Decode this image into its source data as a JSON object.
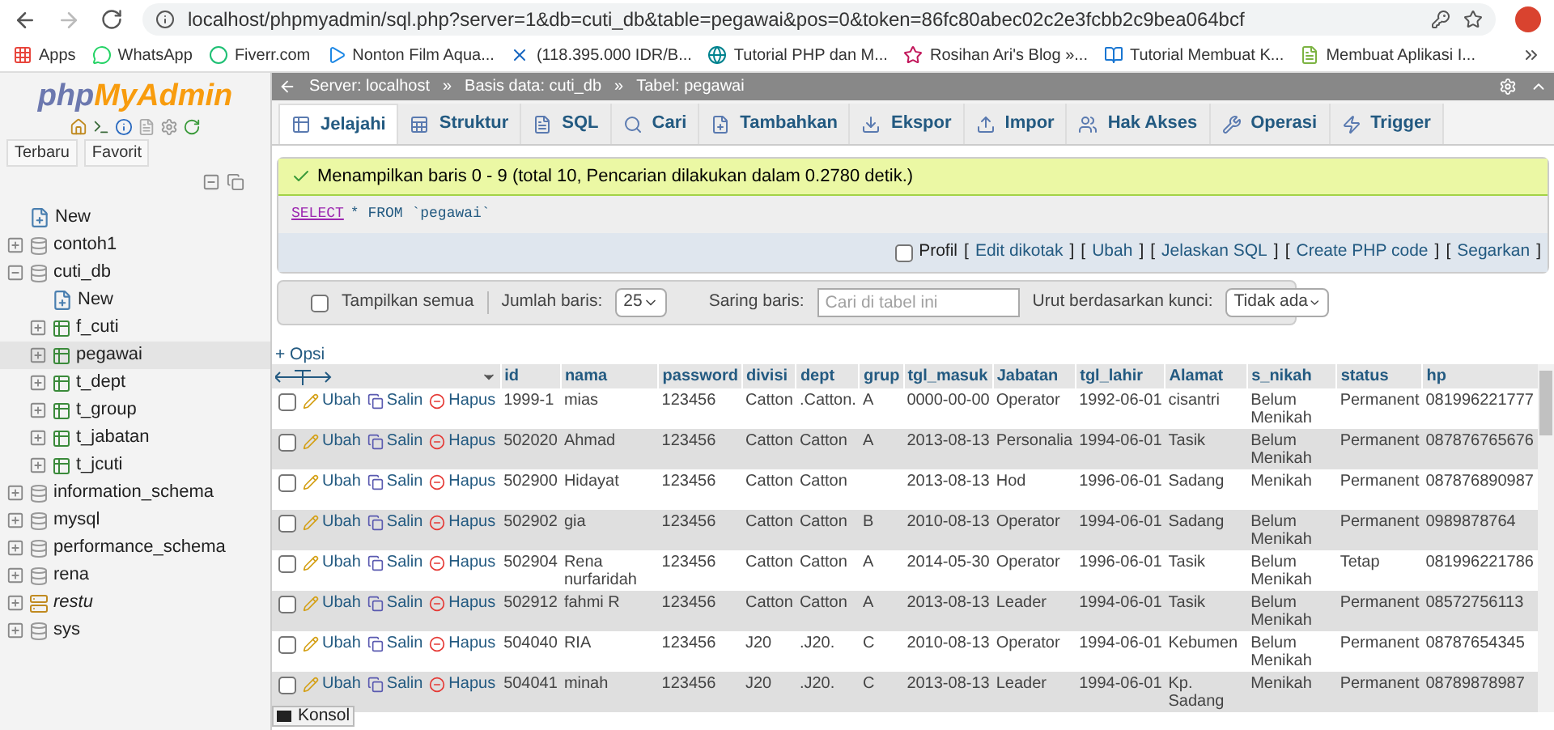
{
  "browser": {
    "url": "localhost/phpmyadmin/sql.php?server=1&db=cuti_db&table=pegawai&pos=0&token=86fc80abec02c2e3fcbb2c9bea064bcf",
    "bookmarks": [
      "Apps",
      "WhatsApp",
      "Fiverr.com",
      "Nonton Film Aqua...",
      "(118.395.000 IDR/B...",
      "Tutorial PHP dan M...",
      "Rosihan Ari's Blog »...",
      "Tutorial Membuat K...",
      "Membuat Aplikasi I..."
    ]
  },
  "sidebar": {
    "logo": {
      "php": "php",
      "name": "MyAdmin"
    },
    "tabs": [
      "Terbaru",
      "Favorit"
    ],
    "tree": [
      {
        "label": "New",
        "kind": "new",
        "selected": false
      },
      {
        "label": "contoh1",
        "kind": "db",
        "expanded": false,
        "selected": false
      },
      {
        "label": "cuti_db",
        "kind": "db",
        "expanded": true,
        "selected": false,
        "children": [
          {
            "label": "New",
            "kind": "new",
            "selected": false
          },
          {
            "label": "f_cuti",
            "kind": "table",
            "expanded": false,
            "selected": false
          },
          {
            "label": "pegawai",
            "kind": "table",
            "expanded": false,
            "selected": true
          },
          {
            "label": "t_dept",
            "kind": "table",
            "expanded": false,
            "selected": false
          },
          {
            "label": "t_group",
            "kind": "table",
            "expanded": false,
            "selected": false
          },
          {
            "label": "t_jabatan",
            "kind": "table",
            "expanded": false,
            "selected": false
          },
          {
            "label": "t_jcuti",
            "kind": "table",
            "expanded": false,
            "selected": false
          }
        ]
      },
      {
        "label": "information_schema",
        "kind": "db",
        "expanded": false,
        "selected": false
      },
      {
        "label": "mysql",
        "kind": "db",
        "expanded": false,
        "selected": false
      },
      {
        "label": "performance_schema",
        "kind": "db",
        "expanded": false,
        "selected": false
      },
      {
        "label": "rena",
        "kind": "db",
        "expanded": false,
        "selected": false
      },
      {
        "label": "restu",
        "kind": "db_special",
        "expanded": false,
        "selected": false
      },
      {
        "label": "sys",
        "kind": "db",
        "expanded": false,
        "selected": false
      }
    ]
  },
  "breadcrumb": {
    "separator": "»",
    "items": [
      "Server: localhost",
      "Basis data: cuti_db",
      "Tabel: pegawai"
    ]
  },
  "tabs": [
    {
      "label": "Jelajahi",
      "selected": true
    },
    {
      "label": "Struktur",
      "selected": false
    },
    {
      "label": "SQL",
      "selected": false
    },
    {
      "label": "Cari",
      "selected": false
    },
    {
      "label": "Tambahkan",
      "selected": false
    },
    {
      "label": "Ekspor",
      "selected": false
    },
    {
      "label": "Impor",
      "selected": false
    },
    {
      "label": "Hak Akses",
      "selected": false
    },
    {
      "label": "Operasi",
      "selected": false
    },
    {
      "label": "Trigger",
      "selected": false
    }
  ],
  "message": "Menampilkan baris 0 - 9 (total 10, Pencarian dilakukan dalam 0.2780 detik.)",
  "query": {
    "keyword": "SELECT",
    "rest": "* FROM `pegawai`"
  },
  "query_options": {
    "profil": {
      "label": "Profil",
      "checked": false
    },
    "open": "[",
    "close": "]",
    "links": [
      "Edit dikotak",
      "Ubah",
      "Jelaskan SQL",
      "Create PHP code",
      "Segarkan"
    ]
  },
  "filter_bar": {
    "show_all": {
      "label": "Tampilkan semua",
      "checked": false
    },
    "rows_label": "Jumlah baris:",
    "rows_value": "25",
    "filter_label": "Saring baris:",
    "filter_placeholder": "Cari di tabel ini",
    "sort_label": "Urut berdasarkan kunci:",
    "sort_value": "Tidak ada"
  },
  "options_link": "+ Opsi",
  "table": {
    "columns": [
      "id",
      "nama",
      "password",
      "divisi",
      "dept",
      "grup",
      "tgl_masuk",
      "Jabatan",
      "tgl_lahir",
      "Alamat",
      "s_nikah",
      "status",
      "hp"
    ],
    "rows": [
      {
        "checked": false,
        "actions": [
          "Ubah",
          "Salin",
          "Hapus"
        ],
        "cells": [
          "1999-1",
          "mias",
          "123456",
          "Catton",
          ".Catton.",
          "A",
          "0000-00-00",
          "Operator",
          "1992-06-01",
          "cisantri",
          "Belum Menikah",
          "Permanent",
          "081996221777"
        ]
      },
      {
        "checked": false,
        "actions": [
          "Ubah",
          "Salin",
          "Hapus"
        ],
        "cells": [
          "502020",
          "Ahmad",
          "123456",
          "Catton",
          "Catton",
          "A",
          "2013-08-13",
          "Personalia",
          "1994-06-01",
          "Tasik",
          "Belum Menikah",
          "Permanent",
          "087876765676"
        ]
      },
      {
        "checked": false,
        "actions": [
          "Ubah",
          "Salin",
          "Hapus"
        ],
        "cells": [
          "502900",
          "Hidayat",
          "123456",
          "Catton",
          "Catton",
          "",
          "2013-08-13",
          "Hod",
          "1996-06-01",
          "Sadang",
          "Menikah",
          "Permanent",
          "087876890987"
        ]
      },
      {
        "checked": false,
        "actions": [
          "Ubah",
          "Salin",
          "Hapus"
        ],
        "cells": [
          "502902",
          "gia",
          "123456",
          "Catton",
          "Catton",
          "B",
          "2010-08-13",
          "Operator",
          "1994-06-01",
          "Sadang",
          "Belum Menikah",
          "Permanent",
          "0989878764"
        ]
      },
      {
        "checked": false,
        "actions": [
          "Ubah",
          "Salin",
          "Hapus"
        ],
        "cells": [
          "502904",
          "Rena nurfaridah",
          "123456",
          "Catton",
          "Catton",
          "A",
          "2014-05-30",
          "Operator",
          "1996-06-01",
          "Tasik",
          "Belum Menikah",
          "Tetap",
          "081996221786"
        ]
      },
      {
        "checked": false,
        "actions": [
          "Ubah",
          "Salin",
          "Hapus"
        ],
        "cells": [
          "502912",
          "fahmi R",
          "123456",
          "Catton",
          "Catton",
          "A",
          "2013-08-13",
          "Leader",
          "1994-06-01",
          "Tasik",
          "Belum Menikah",
          "Permanent",
          "08572756113"
        ]
      },
      {
        "checked": false,
        "actions": [
          "Ubah",
          "Salin",
          "Hapus"
        ],
        "cells": [
          "504040",
          "RIA",
          "123456",
          "J20",
          ".J20.",
          "C",
          "2010-08-13",
          "Operator",
          "1994-06-01",
          "Kebumen",
          "Belum Menikah",
          "Permanent",
          "08787654345"
        ]
      },
      {
        "checked": false,
        "actions": [
          "Ubah",
          "Salin",
          "Hapus"
        ],
        "cells": [
          "504041",
          "minah",
          "123456",
          "J20",
          ".J20.",
          "C",
          "2013-08-13",
          "Leader",
          "1994-06-01",
          "Kp. Sadang",
          "Menikah",
          "Permanent",
          "08789878987"
        ]
      }
    ]
  },
  "console": "Konsol"
}
